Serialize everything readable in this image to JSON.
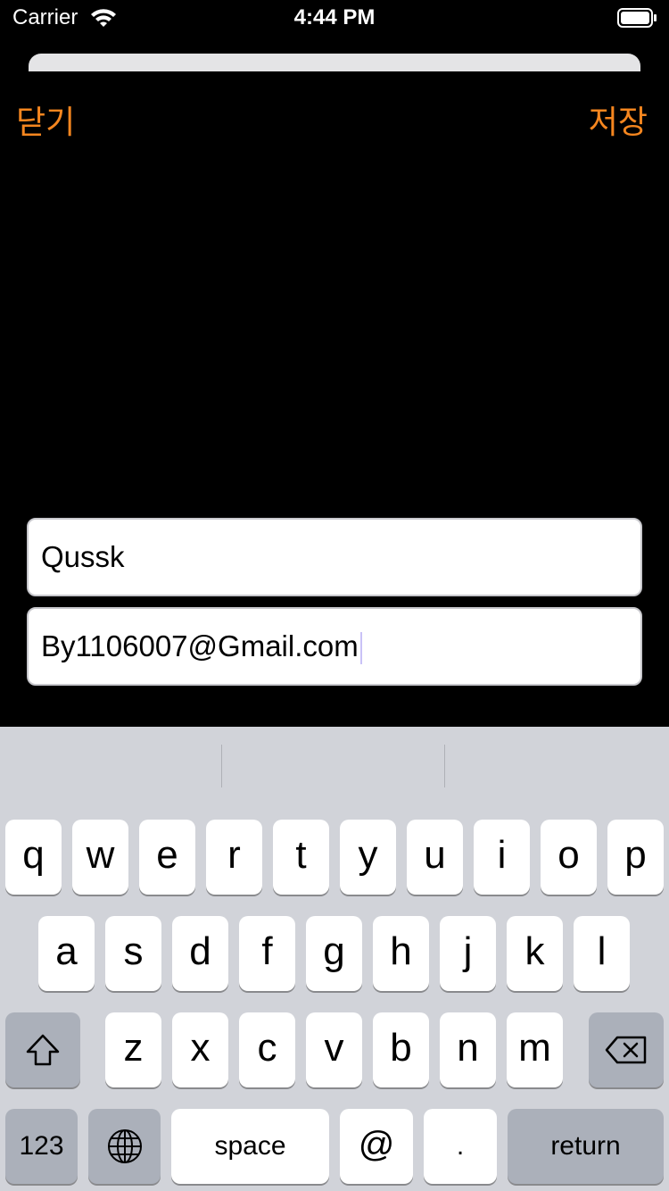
{
  "status_bar": {
    "carrier": "Carrier",
    "time": "4:44 PM"
  },
  "nav": {
    "close_label": "닫기",
    "save_label": "저장"
  },
  "form": {
    "name_value": "Qussk",
    "email_value": "By1106007@Gmail.com"
  },
  "keyboard": {
    "row1": [
      "q",
      "w",
      "e",
      "r",
      "t",
      "y",
      "u",
      "i",
      "o",
      "p"
    ],
    "row2": [
      "a",
      "s",
      "d",
      "f",
      "g",
      "h",
      "j",
      "k",
      "l"
    ],
    "row3": [
      "z",
      "x",
      "c",
      "v",
      "b",
      "n",
      "m"
    ],
    "numbers_label": "123",
    "space_label": "space",
    "at_label": "@",
    "dot_label": ".",
    "return_label": "return"
  },
  "colors": {
    "accent": "#f5861f",
    "keyboard_bg": "#d1d3d9"
  }
}
